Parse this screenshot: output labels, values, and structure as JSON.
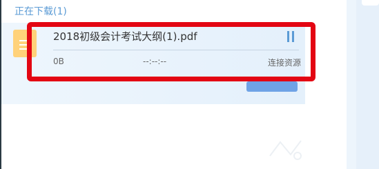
{
  "downloads": {
    "heading": "正在下载(1)",
    "items": [
      {
        "filename": "2018初级会计考试大纲(1).pdf",
        "size": "0B",
        "time_left": "--:--:--",
        "status": "连接资源"
      }
    ]
  },
  "colors": {
    "accent": "#5b9bd5",
    "highlight_border": "#e30613",
    "file_icon": "#ffd27a"
  },
  "icons": {
    "file": "document-icon",
    "pause": "pause-icon"
  }
}
